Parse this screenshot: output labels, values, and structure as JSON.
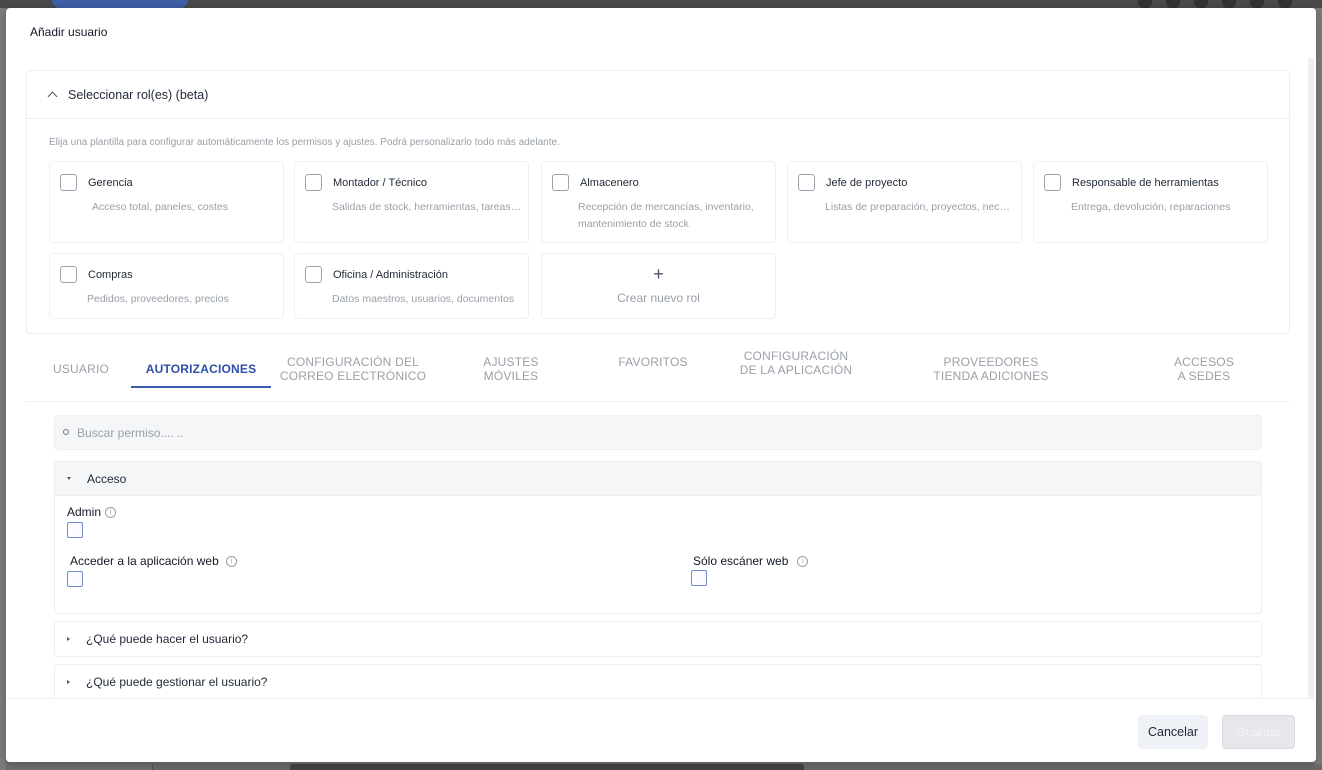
{
  "modal": {
    "title": "Añadir usuario"
  },
  "roles": {
    "section_title": "Seleccionar rol(es) (beta)",
    "hint": "Elija una plantilla para configurar automáticamente los permisos y ajustes. Podrá personalizarlo todo más adelante.",
    "cards": [
      {
        "name": "Gerencia",
        "desc": "Acceso total, paneles, costes"
      },
      {
        "name": "Montador / Técnico",
        "desc": "Salidas de stock, herramientas, tareas — sol..."
      },
      {
        "name": "Almacenero",
        "desc": "Recepción de mercancías, inventario, mantenimiento de stock"
      },
      {
        "name": "Jefe de proyecto",
        "desc": "Listas de preparación, proyectos, necesidad..."
      },
      {
        "name": "Responsable de herramientas",
        "desc": "Entrega, devolución, reparaciones"
      },
      {
        "name": "Compras",
        "desc": "Pedidos, proveedores, precios"
      },
      {
        "name": "Oficina / Administración",
        "desc": "Datos maestros, usuarios, documentos"
      }
    ],
    "new_role_label": "Crear nuevo rol"
  },
  "tabs": [
    {
      "line1": "USUARIO",
      "line2": ""
    },
    {
      "line1": "AUTORIZACIONES",
      "line2": ""
    },
    {
      "line1": "CONFIGURACIÓN DEL",
      "line2": "CORREO ELECTRÓNICO"
    },
    {
      "line1": "AJUSTES",
      "line2": "MÓVILES"
    },
    {
      "line1": "FAVORITOS",
      "line2": ""
    },
    {
      "line1": "CONFIGURACIÓN",
      "line2": "DE LA APLICACIÓN"
    },
    {
      "line1": "PROVEEDORES",
      "line2": "TIENDA ADICIONES"
    },
    {
      "line1": "ACCESOS",
      "line2": "A SEDES"
    }
  ],
  "active_tab": "AUTORIZACIONES",
  "search": {
    "placeholder": "Buscar permiso.... ..",
    "value": ""
  },
  "access": {
    "title": "Acceso",
    "admin_label": "Admin",
    "web_app_label": "Acceder a la aplicación web",
    "scanner_label": "Sólo escáner web"
  },
  "sections": {
    "what_can_do": "¿Qué puede hacer el usuario?",
    "what_can_manage": "¿Qué puede gestionar el usuario?"
  },
  "footer": {
    "cancel_label": "Cancelar",
    "save_label": "Guardar"
  },
  "colors": {
    "accent": "#2f4fa8",
    "muted_text": "#9aa0a8",
    "checkbox_border": "#6f8fd0"
  }
}
